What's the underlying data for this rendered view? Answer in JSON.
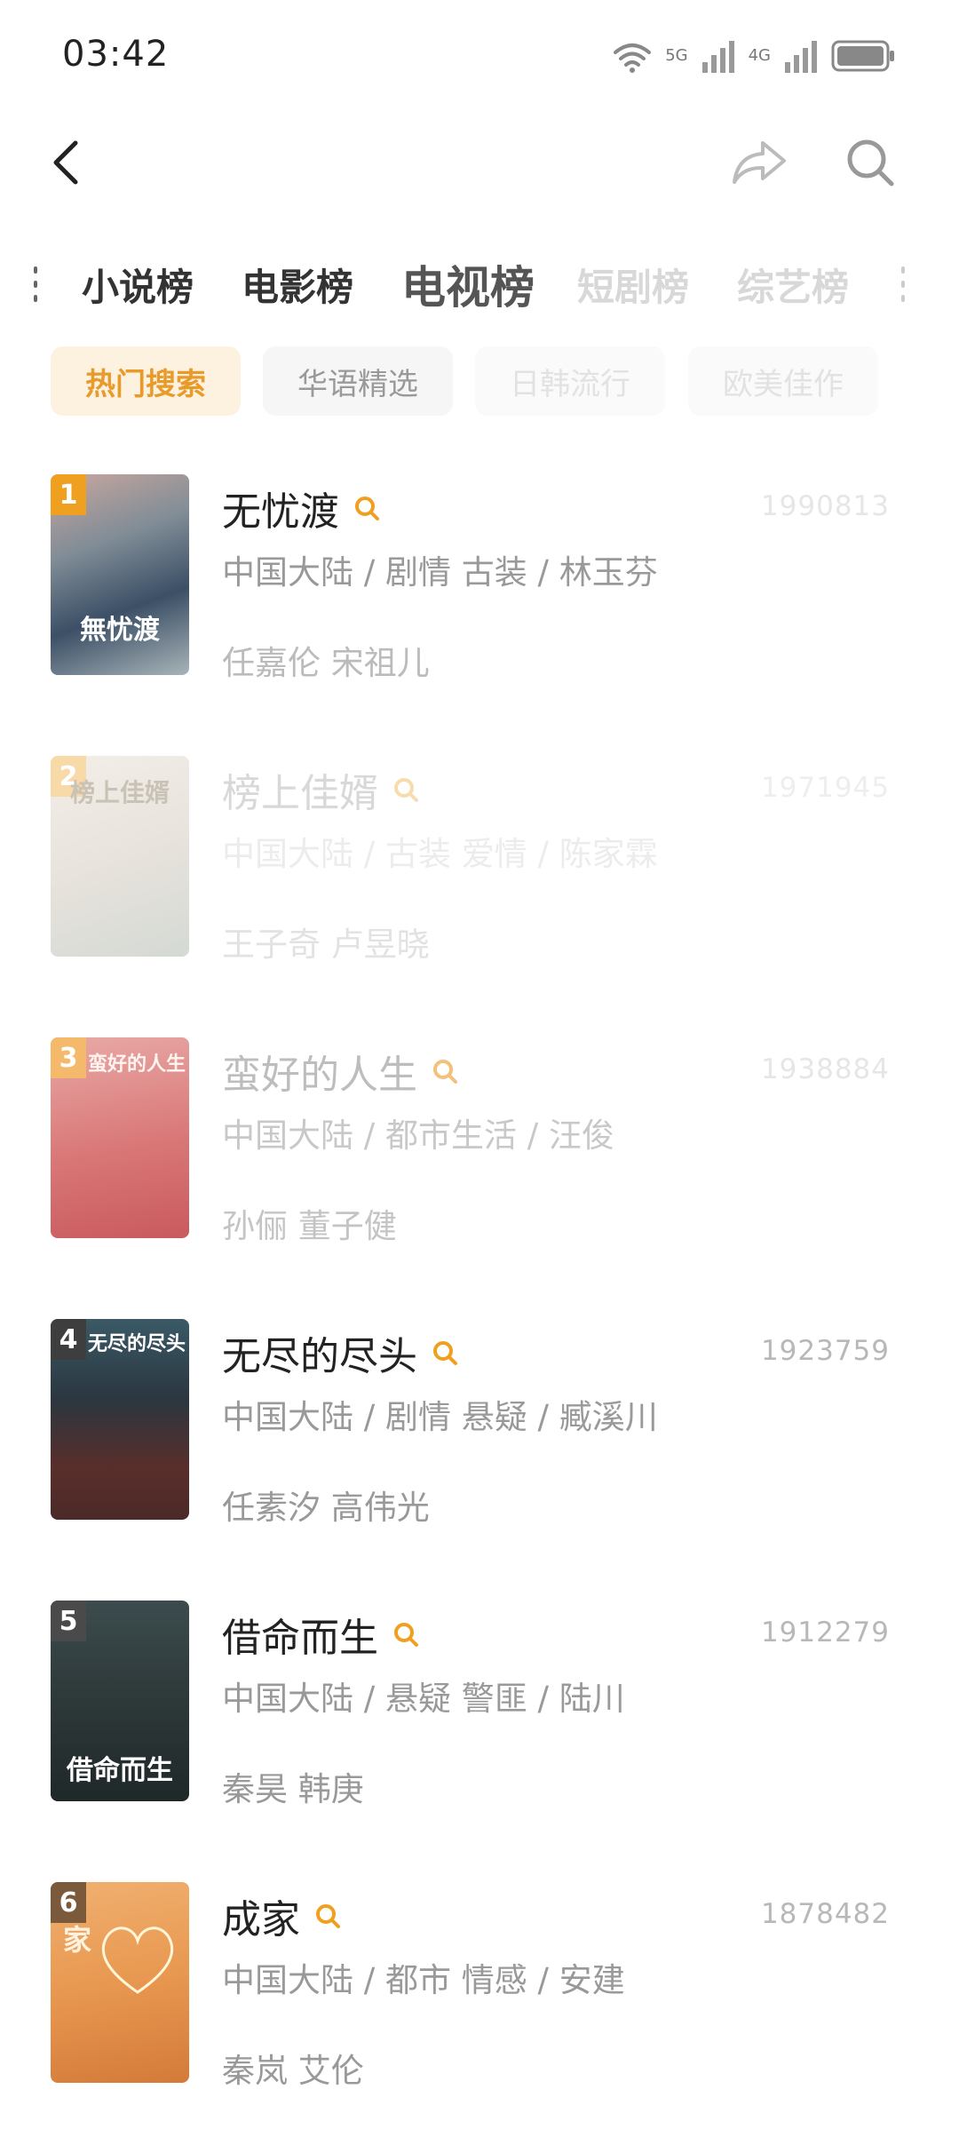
{
  "status_bar": {
    "time": "03:42",
    "net_5g": "5G",
    "net_4g": "4G"
  },
  "nav": {
    "back_icon": "chevron-left-icon",
    "share_icon": "share-icon",
    "search_icon": "search-icon"
  },
  "category_tabs": [
    {
      "label": "小说榜",
      "state": "normal"
    },
    {
      "label": "电影榜",
      "state": "normal"
    },
    {
      "label": "电视榜",
      "state": "active"
    },
    {
      "label": "短剧榜",
      "state": "faded"
    },
    {
      "label": "综艺榜",
      "state": "faded"
    }
  ],
  "filter_chips": [
    {
      "label": "热门搜索",
      "state": "selected"
    },
    {
      "label": "华语精选",
      "state": "normal"
    },
    {
      "label": "日韩流行",
      "state": "faded"
    },
    {
      "label": "欧美佳作",
      "state": "faded"
    }
  ],
  "rank_items": [
    {
      "rank": "1",
      "title": "无忧渡",
      "score": "1990813",
      "meta": "中国大陆 / 剧情 古装 / 林玉芬",
      "cast": "任嘉伦 宋祖儿",
      "poster_text": "無忧渡"
    },
    {
      "rank": "2",
      "title": "榜上佳婿",
      "score": "1971945",
      "meta": "中国大陆 / 古装 爱情 / 陈家霖",
      "cast": "王子奇 卢昱晓",
      "poster_text": "榜上佳婿"
    },
    {
      "rank": "3",
      "title": "蛮好的人生",
      "score": "1938884",
      "meta": "中国大陆 / 都市生活 / 汪俊",
      "cast": "孙俪 董子健",
      "poster_text": "蛮好的人生"
    },
    {
      "rank": "4",
      "title": "无尽的尽头",
      "score": "1923759",
      "meta": "中国大陆 / 剧情 悬疑 / 臧溪川",
      "cast": "任素汐 高伟光",
      "poster_text": "无尽的尽头"
    },
    {
      "rank": "5",
      "title": "借命而生",
      "score": "1912279",
      "meta": "中国大陆 / 悬疑 警匪 / 陆川",
      "cast": "秦昊 韩庚",
      "poster_text": "借命而生"
    },
    {
      "rank": "6",
      "title": "成家",
      "score": "1878482",
      "meta": "中国大陆 / 都市 情感 / 安建",
      "cast": "秦岚 艾伦",
      "poster_text": "家"
    }
  ],
  "colors": {
    "accent": "#f0a020",
    "chip_selected_bg": "#fdf1e0",
    "chip_selected_text": "#e89a2a",
    "score_text": "#b8b8b8"
  }
}
